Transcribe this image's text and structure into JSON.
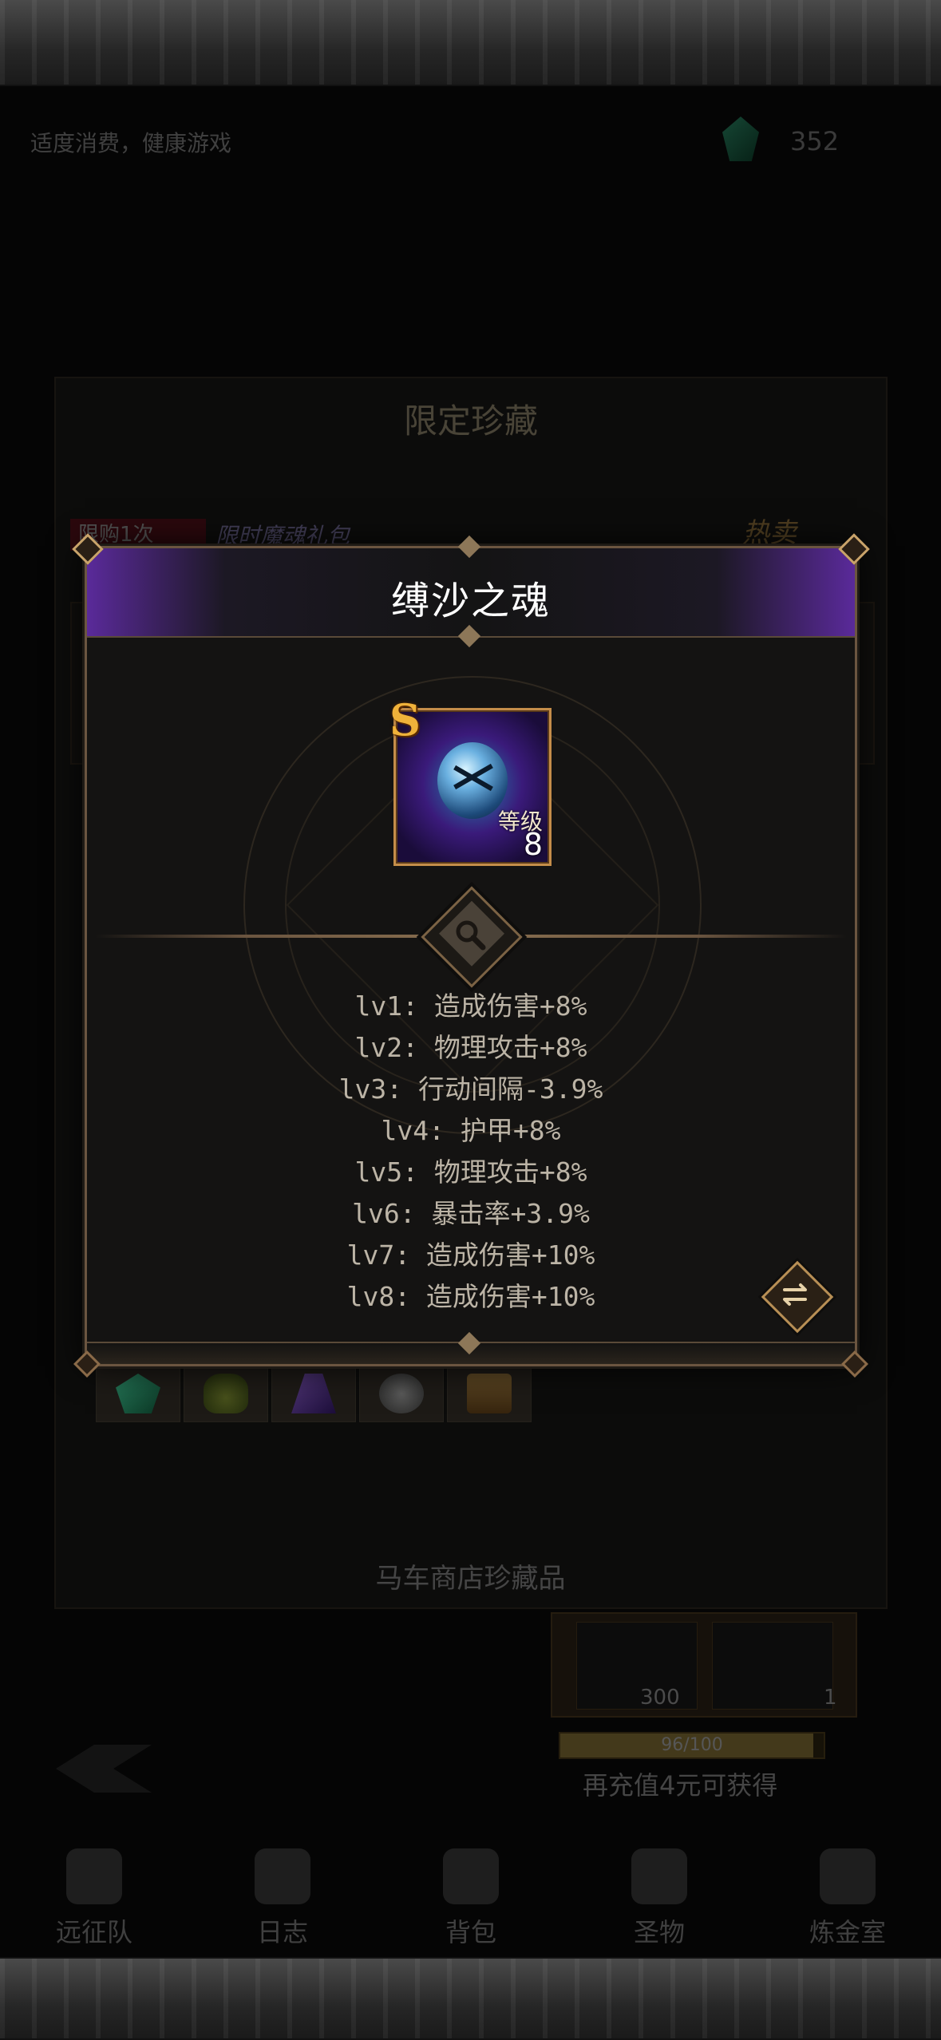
{
  "background": {
    "tip": "适度消费，健康游戏",
    "currency_count": "352",
    "panel_title": "限定珍藏",
    "badge": "限购1次",
    "badge_title": "限时魔魂礼包",
    "hot_label": "热卖",
    "shop_name": "马车商店珍藏品",
    "reward_counts": [
      "300",
      "1"
    ],
    "progress_text": "96/100",
    "progress_fraction": 0.96,
    "recharge_hint": "再充值4元可获得",
    "nav": [
      "远征队",
      "日志",
      "背包",
      "圣物",
      "炼金室"
    ]
  },
  "modal": {
    "title": "缚沙之魂",
    "item": {
      "rank": "S",
      "level_label": "等级",
      "level": "8"
    },
    "stats": [
      "lv1: 造成伤害+8%",
      "lv2: 物理攻击+8%",
      "lv3: 行动间隔-3.9%",
      "lv4: 护甲+8%",
      "lv5: 物理攻击+8%",
      "lv6: 暴击率+3.9%",
      "lv7: 造成伤害+10%",
      "lv8: 造成伤害+10%"
    ]
  },
  "icons": {
    "zoom": "magnifier-icon",
    "swap": "swap-arrows-icon"
  },
  "colors": {
    "accent_gold": "#c9a36a",
    "rank_s": "#f0b23a",
    "rarity_purple": "#5a2a9a"
  }
}
